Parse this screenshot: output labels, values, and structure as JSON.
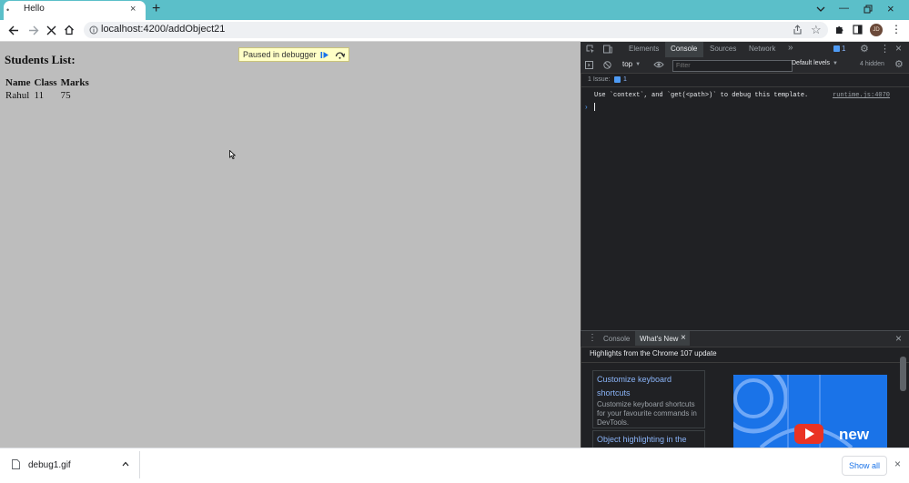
{
  "browser": {
    "tab_title": "Hello",
    "tab_close": "×",
    "new_tab": "+",
    "url": "localhost:4200/addObject21",
    "profile_initials": "JD"
  },
  "page": {
    "heading": "Students List:",
    "table": {
      "headers": [
        "Name",
        "Class",
        "Marks"
      ],
      "rows": [
        [
          "Rahul",
          "11",
          "75"
        ]
      ]
    },
    "paused_banner": "Paused in debugger"
  },
  "devtools": {
    "tabs": [
      "Elements",
      "Console",
      "Sources",
      "Network"
    ],
    "more_tabs": "»",
    "issues_badge": "1",
    "context": "top",
    "filter_placeholder": "Filter",
    "levels": "Default levels",
    "hidden": "4 hidden",
    "issues_label": "1 Issue:",
    "issues_count": "1",
    "console_message": "Use `context`, and `get(<path>)` to debug this template.",
    "console_source": "runtime.js:4070",
    "drawer": {
      "tabs": [
        "Console",
        "What's New"
      ],
      "close": "×",
      "highlights_title": "Highlights from the Chrome 107 update",
      "cards": [
        {
          "title": "Customize keyboard shortcuts",
          "desc": "Customize keyboard shortcuts for your favourite commands in DevTools."
        },
        {
          "title": "Object highlighting in the",
          "desc": ""
        }
      ],
      "promo_text": "new"
    }
  },
  "download": {
    "file_name": "debug1.gif",
    "show_all": "Show all",
    "close": "×"
  },
  "colors": {
    "tabstrip": "#5bbfc9",
    "viewport_dim": "#bdbdbd",
    "devtools_bg": "#202124",
    "link_blue": "#8ab4f8",
    "paused_yellow": "#ffffc6"
  }
}
